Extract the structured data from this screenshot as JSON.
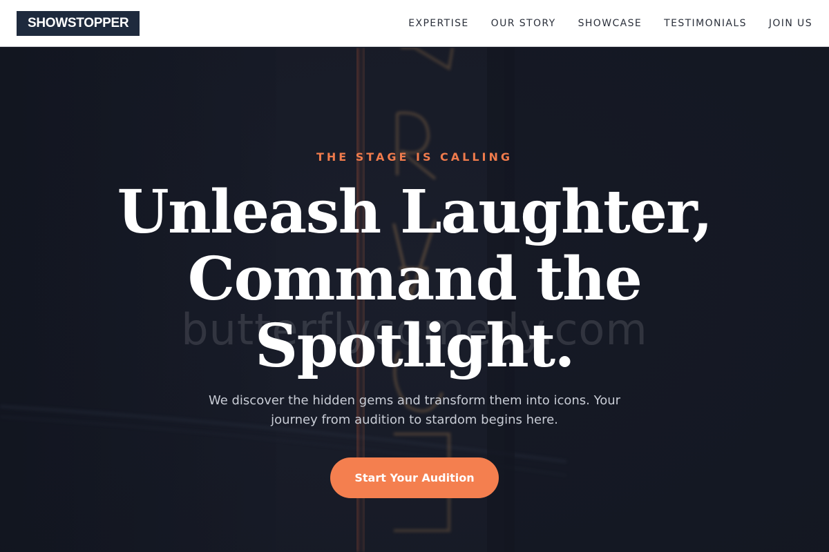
{
  "header": {
    "logo": "SHOWSTOPPER",
    "nav": [
      {
        "label": "EXPERTISE"
      },
      {
        "label": "OUR STORY"
      },
      {
        "label": "SHOWCASE"
      },
      {
        "label": "TESTIMONIALS"
      },
      {
        "label": "JOIN US"
      }
    ]
  },
  "hero": {
    "eyebrow": "THE STAGE IS CALLING",
    "headline_lines": [
      "Unleash Laughter,",
      "Command the",
      "Spotlight."
    ],
    "subtext": "We discover the hidden gems and transform them into icons. Your journey from audition to stardom begins here.",
    "cta_label": "Start Your Audition",
    "watermark": "butterflycomedy.com"
  },
  "colors": {
    "accent": "#f47f4f",
    "header_bg": "#ffffff",
    "logo_bg": "#1e2a3d",
    "hero_bg": "#161a27",
    "neon": "#c4794a"
  }
}
